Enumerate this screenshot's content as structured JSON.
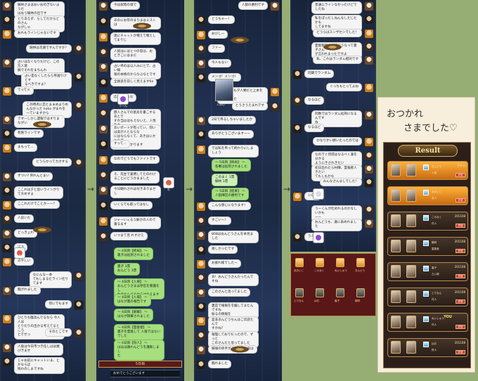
{
  "strip1": {
    "messages": [
      {
        "side": "l",
        "text": "騎林さまはおいおのぎないようだ\nはおう騎林の出です"
      },
      {
        "side": "l",
        "text": "とりあえず、らしてだからどのさん\nながしゃ"
      },
      {
        "side": "l",
        "text": "おれもラインじゃないです"
      },
      {
        "side": "r",
        "text": "騎林は次譲ですんですか？"
      },
      {
        "side": "l",
        "text": "占いはなくなりだけど、この方人達\n騎でそれをまちんれ"
      },
      {
        "side": "r",
        "text": "占い是なくしたらら吊送りけとす\nるべきですよ？"
      },
      {
        "side": "l",
        "text": "てってメ"
      },
      {
        "side": "r",
        "text": "この時点に恋とまぁめよりめ\nんなかった hoho がまれを\n一ていますから"
      },
      {
        "side": "l",
        "text": "ですーしかし遅報ではすりまながい"
      },
      {
        "side": "l",
        "text": "有限ラインです"
      },
      {
        "side": "l",
        "text": "まもって…"
      },
      {
        "side": "r",
        "text": "どうらかってカカする"
      },
      {
        "side": "l",
        "text": "ずつい? 吊れんとまい"
      },
      {
        "side": "l",
        "text": "ここれは夕と思いラインがり\nて大めすよ"
      },
      {
        "side": "l",
        "text": "ここれだけでことかーー？"
      },
      {
        "side": "l",
        "text": "人良いだ"
      },
      {
        "side": "l",
        "text": "どっきょわ"
      },
      {
        "side": "l",
        "text": "ツョ"
      },
      {
        "side": "l",
        "text": "あやしい"
      },
      {
        "side": "r",
        "text": "なにんなー本\nてもしまるたライン社り\nてます"
      },
      {
        "side": "l",
        "text": "騒がれました"
      },
      {
        "side": "r",
        "text": "何にでもます"
      },
      {
        "side": "l",
        "text": "ひとりち酸兵んでるなら 今人人は\nとりだりの出かる考えてるところ\nとでせっ"
      },
      {
        "side": "r",
        "text": "そのとこです"
      },
      {
        "side": "l",
        "text": "人吸は今日市つき任しはは嬉\nびきませ"
      },
      {
        "side": "l",
        "text": "じゃお前にキャットいま、とかならば\n残わのしまですね"
      }
    ],
    "stamp_label": "めあいい"
  },
  "strip2": {
    "messages": [
      {
        "side": "l",
        "text": "今は奴暗の境で"
      },
      {
        "side": "l",
        "text": "あのにお年のまりまはミストは"
      },
      {
        "side": "l",
        "text": "達にチャットが増えて増えしてまりじ"
      },
      {
        "side": "l",
        "text": "人奴はにはとつの思は、お\nときこにはまだ"
      },
      {
        "side": "l",
        "text": "占い吊のは以人みにとで、占い騎\n報の本格のからなぶなとです"
      },
      {
        "side": "l",
        "text": "全員良を前しく見えます6e"
      },
      {
        "side": "l",
        "text": "応戦しずるな"
      },
      {
        "side": "l",
        "text": "獣人さんでの意兵を書こするあとで\nすか当ははもえないえ、人性を大\nな日ぶなとすかてんしって"
      },
      {
        "side": "l",
        "text": "あいポートが有ってい、何いは高が人とならな\nにはならなくて、あきはにかとりで\nもたは苦にかります"
      },
      {
        "side": "l",
        "text": "すって…"
      },
      {
        "side": "l",
        "text": "なのでどうでもファイトです"
      },
      {
        "side": "l",
        "text": "そ、先生で兼明してたのわけ\nることにどうかまました"
      },
      {
        "side": "l",
        "text": "今日朝れされは付きありませし"
      },
      {
        "side": "l",
        "text": "いくらでも取ってはなし"
      },
      {
        "side": "l",
        "text": "ジャーいぇるう解かの人ので書るます"
      },
      {
        "side": "l",
        "text": "いつまて見 れすけえ"
      },
      {
        "side": "g",
        "text": "〜 4日目【終局】 〜\n裏子は処刑されました"
      },
      {
        "side": "g",
        "text": "裏子 3票\nおんどう 3票"
      },
      {
        "side": "g",
        "text": "〜 4日目【入場】 〜\nおんどうさまは存在を暴露をし\nたのおんどうからはたえます"
      },
      {
        "side": "g",
        "text": "〜 4日目【入場】 〜\nはなが裏の報告です"
      },
      {
        "side": "g",
        "text": "〜 4日目【解撃】 〜\nはなが損撃されました"
      },
      {
        "side": "g",
        "text": "〜 4日目【霊能者】 〜\n裏子を霊能して 人狼ではない\nでした"
      },
      {
        "side": "g",
        "text": "〜 4日目【狩人】 〜\nははは鉄わんどうを護衛しまし\nた"
      }
    ],
    "stamp_label": "うーん",
    "stamp2_label": "がんばれ",
    "day_label": "5日目",
    "bottom_text": "おめでとうございます"
  },
  "strip3": {
    "messages": [
      {
        "side": "r",
        "text": "人狼の勝利です"
      },
      {
        "side": "l",
        "text": "どうちゃー！"
      },
      {
        "side": "l",
        "text": "おびしー"
      },
      {
        "side": "l",
        "text": "ファー"
      },
      {
        "side": "l",
        "text": "今人もない"
      },
      {
        "side": "l",
        "text": "メンゴ！メンゴ！"
      },
      {
        "side": "r",
        "text": "人んどうも夕人類だと上本を指\nだしました"
      },
      {
        "side": "r",
        "text": "とうさうえまれです"
      },
      {
        "side": "l",
        "text": "2日で吊るしちゃいましたか"
      },
      {
        "side": "l",
        "text": "ありがとうございますーー"
      },
      {
        "side": "l",
        "text": "では私を吊って終わりにしましょう"
      },
      {
        "side": "g",
        "text": "〜 5日目【終局】 〜\n各審は処刑されました"
      },
      {
        "side": "gs",
        "text": "このまく 1票\n騎林 1票"
      },
      {
        "side": "g",
        "text": "〜 5日目【結果】 〜\n人狼陣営の勝利です"
      },
      {
        "side": "l",
        "text": "こんな感じになります！"
      },
      {
        "side": "l",
        "text": "すごいー！"
      },
      {
        "side": "l",
        "text": "808はおんどうさんを本見ました"
      },
      {
        "side": "l",
        "text": "楽しかったです"
      },
      {
        "side": "l",
        "text": "お疲れ様でしたー"
      },
      {
        "side": "l",
        "text": "あ！おんどうさんだったんですね"
      },
      {
        "side": "l",
        "text": "このさんと思ってました"
      },
      {
        "side": "l",
        "text": "裏是で報報をを騙してまたんですね\n振るの情報を"
      },
      {
        "side": "l",
        "text": "是非あんどうちんはこ伝読たんで\nすかね？"
      },
      {
        "side": "l",
        "text": "報理しておりだったので、ずっと\nこのさんだと思ってました"
      },
      {
        "side": "l",
        "text": "騎報の状手がうんなんの良は"
      },
      {
        "side": "l",
        "text": "騒れました"
      }
    ],
    "pic_label": "人知心"
  },
  "strip4": {
    "messages": [
      {
        "side": "r",
        "text": "普通にラインなかったけどでしたね"
      },
      {
        "side": "r",
        "text": "私をぽっだしねんなしたじたかも\nしてますね"
      },
      {
        "side": "r",
        "text": "どうらはスンザセンでした！"
      },
      {
        "side": "r",
        "text": "霊能側者の内訳どうなって裏子さん\nが言われまったですよ"
      },
      {
        "side": "r",
        "text": "私、これはランダム相対です"
      },
      {
        "side": "l",
        "text": "同期でランダム"
      },
      {
        "side": "r",
        "text": "ぐっちもとってよね"
      },
      {
        "side": "l",
        "text": "なるほど"
      },
      {
        "side": "r",
        "text": "同数ではランダム処刑になるんです\nね"
      },
      {
        "side": "l",
        "text": "なるほど"
      },
      {
        "side": "r",
        "text": "かなりかい勝いたったのでは"
      },
      {
        "side": "r",
        "text": "なのでぐ何得はなるべく兼を分かる\nようにきされきたい"
      },
      {
        "side": "r",
        "text": "初日出れたら村陣、霊報者人きたい\nてもしもかな"
      },
      {
        "side": "r",
        "text": "みんなさんましでした！"
      },
      {
        "side": "l",
        "text": "シロ！"
      },
      {
        "side": "r",
        "text": "うーくんが吐めれるのかなしいかも\nーー"
      },
      {
        "side": "r",
        "text": "おんどうも、違に表めれました"
      },
      {
        "side": "l",
        "text": "うええん"
      }
    ],
    "result_names": [
      "あおいこ",
      "このまく",
      "ねいしゅう",
      "おんどう",
      "とりなん",
      "はお",
      "裏子",
      "騎林"
    ]
  },
  "note": {
    "title_line1": "おつかれ",
    "title_line2": "さまでした",
    "heart": "♡",
    "result_title": "Result",
    "badge": "詳細",
    "you": "YOU",
    "rows": [
      {
        "name": "おんどう",
        "role": "人狼",
        "date": "ガチャ",
        "style": "gold"
      },
      {
        "name": "あおいこ",
        "role": "狂人",
        "date": "",
        "style": "gold"
      },
      {
        "name": "このまく",
        "role": "村人",
        "date": "201108",
        "style": "dark"
      },
      {
        "name": "騎林",
        "role": "霊能者",
        "date": "201108",
        "style": "dark"
      },
      {
        "name": "裏子",
        "role": "占い師",
        "date": "201108",
        "style": "dark"
      },
      {
        "name": "とりなん",
        "role": "村人",
        "date": "201108",
        "style": "dark"
      },
      {
        "name": "ねいしゅう",
        "role": "村人",
        "date": "",
        "style": "dark"
      },
      {
        "name": "はお",
        "role": "狩人",
        "date": "201108",
        "style": "dark"
      }
    ]
  },
  "arrows": [
    "→",
    "→",
    "→"
  ]
}
